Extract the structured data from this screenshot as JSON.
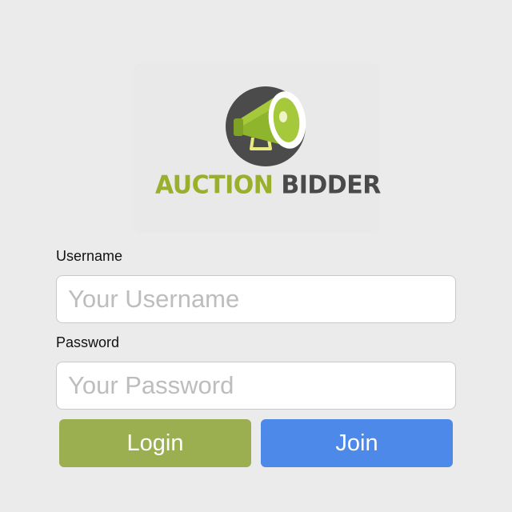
{
  "brand": {
    "logo_icon": "megaphone-icon",
    "name_part1": "AUCTION",
    "name_part2": "BIDDER",
    "colors": {
      "accent_green": "#9aaf2b",
      "dark_gray": "#4a4a4a"
    }
  },
  "form": {
    "username_label": "Username",
    "username_placeholder": "Your Username",
    "username_value": "",
    "password_label": "Password",
    "password_placeholder": "Your Password",
    "password_value": ""
  },
  "actions": {
    "login_label": "Login",
    "join_label": "Join",
    "login_color": "#9caf50",
    "join_color": "#4c89e8"
  }
}
